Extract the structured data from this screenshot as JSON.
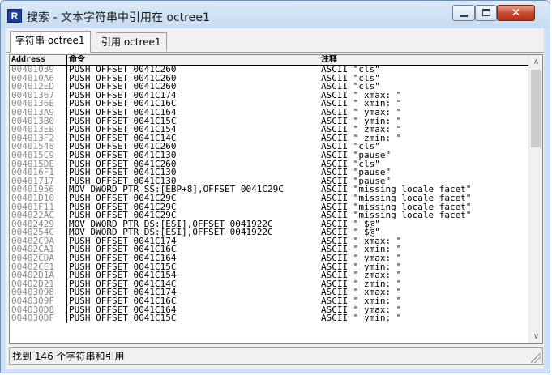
{
  "window": {
    "app_icon_letter": "R",
    "title": "搜索 - 文本字符串中引用在 octree1",
    "close_glyph": "✕"
  },
  "tabs": [
    {
      "label": "字符串 octree1"
    },
    {
      "label": "引用 octree1"
    }
  ],
  "table": {
    "columns": [
      "Address",
      "命令",
      "注释"
    ],
    "rows": [
      {
        "address": "00401039",
        "command": "PUSH OFFSET 0041C260",
        "comment": "ASCII \"cls\""
      },
      {
        "address": "004010A6",
        "command": "PUSH OFFSET 0041C260",
        "comment": "ASCII \"cls\""
      },
      {
        "address": "004012ED",
        "command": "PUSH OFFSET 0041C260",
        "comment": "ASCII \"cls\""
      },
      {
        "address": "00401367",
        "command": "PUSH OFFSET 0041C174",
        "comment": "ASCII \" xmax: \""
      },
      {
        "address": "0040136E",
        "command": "PUSH OFFSET 0041C16C",
        "comment": "ASCII \" xmin: \""
      },
      {
        "address": "004013A9",
        "command": "PUSH OFFSET 0041C164",
        "comment": "ASCII \" ymax: \""
      },
      {
        "address": "004013B0",
        "command": "PUSH OFFSET 0041C15C",
        "comment": "ASCII \" ymin: \""
      },
      {
        "address": "004013EB",
        "command": "PUSH OFFSET 0041C154",
        "comment": "ASCII \" zmax: \""
      },
      {
        "address": "004013F2",
        "command": "PUSH OFFSET 0041C14C",
        "comment": "ASCII \" zmin: \""
      },
      {
        "address": "00401548",
        "command": "PUSH OFFSET 0041C260",
        "comment": "ASCII \"cls\""
      },
      {
        "address": "004015C9",
        "command": "PUSH OFFSET 0041C130",
        "comment": "ASCII \"pause\""
      },
      {
        "address": "004015DE",
        "command": "PUSH OFFSET 0041C260",
        "comment": "ASCII \"cls\""
      },
      {
        "address": "004016F1",
        "command": "PUSH OFFSET 0041C130",
        "comment": "ASCII \"pause\""
      },
      {
        "address": "00401717",
        "command": "PUSH OFFSET 0041C130",
        "comment": "ASCII \"pause\""
      },
      {
        "address": "00401956",
        "command": "MOV DWORD PTR SS:[EBP+8],OFFSET 0041C29C",
        "comment": "ASCII \"missing locale facet\""
      },
      {
        "address": "00401D10",
        "command": "PUSH OFFSET 0041C29C",
        "comment": "ASCII \"missing locale facet\""
      },
      {
        "address": "00401F11",
        "command": "PUSH OFFSET 0041C29C",
        "comment": "ASCII \"missing locale facet\""
      },
      {
        "address": "004022AC",
        "command": "PUSH OFFSET 0041C29C",
        "comment": "ASCII \"missing locale facet\""
      },
      {
        "address": "00402429",
        "command": "MOV DWORD PTR DS:[ESI],OFFSET 0041922C",
        "comment": "ASCII \" $@\""
      },
      {
        "address": "0040254C",
        "command": "MOV DWORD PTR DS:[ESI],OFFSET 0041922C",
        "comment": "ASCII \" $@\""
      },
      {
        "address": "00402C9A",
        "command": "PUSH OFFSET 0041C174",
        "comment": "ASCII \" xmax: \""
      },
      {
        "address": "00402CA1",
        "command": "PUSH OFFSET 0041C16C",
        "comment": "ASCII \" xmin: \""
      },
      {
        "address": "00402CDA",
        "command": "PUSH OFFSET 0041C164",
        "comment": "ASCII \" ymax: \""
      },
      {
        "address": "00402CE1",
        "command": "PUSH OFFSET 0041C15C",
        "comment": "ASCII \" ymin: \""
      },
      {
        "address": "00402D1A",
        "command": "PUSH OFFSET 0041C154",
        "comment": "ASCII \" zmax: \""
      },
      {
        "address": "00402D21",
        "command": "PUSH OFFSET 0041C14C",
        "comment": "ASCII \" zmin: \""
      },
      {
        "address": "00403098",
        "command": "PUSH OFFSET 0041C174",
        "comment": "ASCII \" xmax: \""
      },
      {
        "address": "0040309F",
        "command": "PUSH OFFSET 0041C16C",
        "comment": "ASCII \" xmin: \""
      },
      {
        "address": "004030D8",
        "command": "PUSH OFFSET 0041C164",
        "comment": "ASCII \" ymax: \""
      },
      {
        "address": "004030DF",
        "command": "PUSH OFFSET 0041C15C",
        "comment": "ASCII \" ymin: \""
      }
    ]
  },
  "scrollbar": {
    "up_arrow": "∧",
    "down_arrow": "∨"
  },
  "status": {
    "text": "找到 146 个字符串和引用"
  }
}
